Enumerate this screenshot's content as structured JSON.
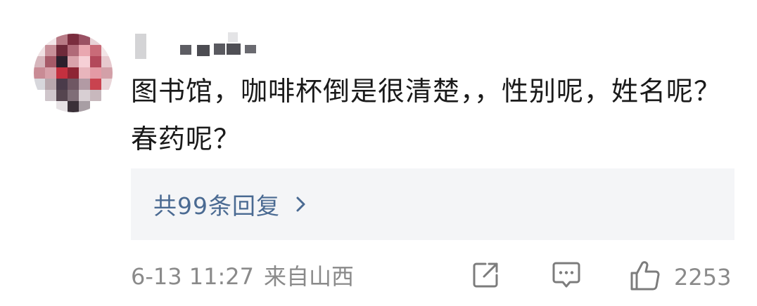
{
  "comment": {
    "text": "图书馆，咖啡杯倒是很清楚，，性别呢，姓名呢？春药呢？",
    "replies_label": "共99条回复",
    "date": "6-13 11:27",
    "location": "来自山西",
    "like_count": "2253"
  },
  "icons": {
    "avatar": "avatar-pixelated",
    "replies_chevron": "chevron-right-icon",
    "share": "share-icon",
    "reply": "comment-icon",
    "like": "thumbs-up-icon"
  },
  "colors": {
    "text": "#1a1a1a",
    "link": "#4a6a92",
    "meta": "#8a8a8a",
    "reply_box_bg": "#f4f5f7"
  }
}
